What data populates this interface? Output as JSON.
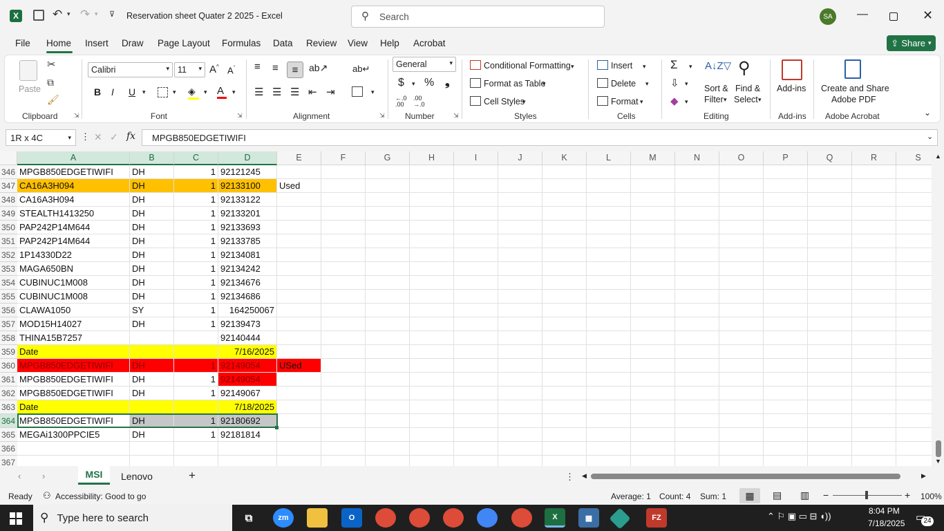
{
  "window": {
    "title": "Reservation sheet Quater 2 2025  -  Excel",
    "search_placeholder": "Search",
    "avatar": "SA"
  },
  "menu": [
    "File",
    "Home",
    "Insert",
    "Draw",
    "Page Layout",
    "Formulas",
    "Data",
    "Review",
    "View",
    "Help",
    "Acrobat"
  ],
  "share_label": "Share",
  "ribbon": {
    "clipboard": {
      "paste": "Paste",
      "label": "Clipboard"
    },
    "font": {
      "name": "Calibri",
      "size": "11",
      "label": "Font"
    },
    "alignment": {
      "label": "Alignment"
    },
    "number": {
      "format": "General",
      "label": "Number"
    },
    "styles": {
      "conditional": "Conditional Formatting",
      "table": "Format as Table",
      "cell_styles": "Cell Styles",
      "label": "Styles"
    },
    "cells": {
      "insert": "Insert",
      "delete": "Delete",
      "format": "Format",
      "label": "Cells"
    },
    "editing": {
      "sort1": "Sort &",
      "sort2": "Filter",
      "find1": "Find &",
      "find2": "Select",
      "label": "Editing"
    },
    "addins": {
      "btn": "Add-ins",
      "label": "Add-ins"
    },
    "acrobat": {
      "btn1": "Create and Share",
      "btn2": "Adobe PDF",
      "label": "Adobe Acrobat"
    }
  },
  "namebox": "1R x 4C",
  "formula": "MPGB850EDGETIWIFI",
  "columns": [
    "A",
    "B",
    "C",
    "D",
    "E",
    "F",
    "G",
    "H",
    "I",
    "J",
    "K",
    "L",
    "M",
    "N",
    "O",
    "P",
    "Q",
    "R",
    "S"
  ],
  "rows": [
    {
      "n": "346",
      "a": "MPGB850EDGETIWIFI",
      "b": "DH",
      "c": "1",
      "d": "92121245",
      "e": "",
      "style": ""
    },
    {
      "n": "347",
      "a": "CA16A3H094",
      "b": "DH",
      "c": "1",
      "d": "92133100",
      "e": "Used",
      "style": "orange"
    },
    {
      "n": "348",
      "a": "CA16A3H094",
      "b": "DH",
      "c": "1",
      "d": "92133122",
      "e": "",
      "style": ""
    },
    {
      "n": "349",
      "a": "STEALTH1413250",
      "b": "DH",
      "c": "1",
      "d": "92133201",
      "e": "",
      "style": ""
    },
    {
      "n": "350",
      "a": "PAP242P14M644",
      "b": "DH",
      "c": "1",
      "d": "92133693",
      "e": "",
      "style": ""
    },
    {
      "n": "351",
      "a": "PAP242P14M644",
      "b": "DH",
      "c": "1",
      "d": "92133785",
      "e": "",
      "style": ""
    },
    {
      "n": "352",
      "a": "1P14330D22",
      "b": "DH",
      "c": "1",
      "d": "92134081",
      "e": "",
      "style": ""
    },
    {
      "n": "353",
      "a": "MAGA650BN",
      "b": "DH",
      "c": "1",
      "d": "92134242",
      "e": "",
      "style": ""
    },
    {
      "n": "354",
      "a": "CUBINUC1M008",
      "b": "DH",
      "c": "1",
      "d": "92134676",
      "e": "",
      "style": ""
    },
    {
      "n": "355",
      "a": "CUBINUC1M008",
      "b": "DH",
      "c": "1",
      "d": "92134686",
      "e": "",
      "style": ""
    },
    {
      "n": "356",
      "a": "CLAWA1050",
      "b": "SY",
      "c": "1",
      "d": "164250067",
      "e": "",
      "style": "sy"
    },
    {
      "n": "357",
      "a": "MOD15H14027",
      "b": "DH",
      "c": "1",
      "d": "92139473",
      "e": "",
      "style": ""
    },
    {
      "n": "358",
      "a": "THINA15B7257",
      "b": "",
      "c": "",
      "d": "92140444",
      "e": "",
      "style": ""
    },
    {
      "n": "359",
      "a": "Date",
      "b": "",
      "c": "",
      "d": "7/16/2025",
      "e": "",
      "style": "date"
    },
    {
      "n": "360",
      "a": "MPGB850EDGETIWIFI",
      "b": "DH",
      "c": "1",
      "d": "92149054",
      "e": "USed",
      "style": "red"
    },
    {
      "n": "361",
      "a": "MPGB850EDGETIWIFI",
      "b": "DH",
      "c": "1",
      "d": "92149054",
      "e": "",
      "style": "redd"
    },
    {
      "n": "362",
      "a": "MPGB850EDGETIWIFI",
      "b": "DH",
      "c": "1",
      "d": "92149067",
      "e": "",
      "style": ""
    },
    {
      "n": "363",
      "a": "Date",
      "b": "",
      "c": "",
      "d": "7/18/2025",
      "e": "",
      "style": "date"
    },
    {
      "n": "364",
      "a": "MPGB850EDGETIWIFI",
      "b": "DH",
      "c": "1",
      "d": "92180692",
      "e": "",
      "style": "sel"
    },
    {
      "n": "365",
      "a": "MEGAi1300PPCIE5",
      "b": "DH",
      "c": "1",
      "d": "92181814",
      "e": "",
      "style": ""
    },
    {
      "n": "366",
      "a": "",
      "b": "",
      "c": "",
      "d": "",
      "e": "",
      "style": ""
    },
    {
      "n": "367",
      "a": "",
      "b": "",
      "c": "",
      "d": "",
      "e": "",
      "style": ""
    }
  ],
  "sheets": [
    "MSI",
    "Lenovo"
  ],
  "status": {
    "ready": "Ready",
    "accessibility": "Accessibility: Good to go",
    "average": "Average: 1",
    "count": "Count: 4",
    "sum": "Sum: 1",
    "zoom": "100%"
  },
  "taskbar": {
    "search": "Type here to search",
    "time": "8:04 PM",
    "date": "7/18/2025",
    "badge": "24"
  },
  "colors": {
    "excel_green": "#217346",
    "orange": "#ffc000",
    "yellow": "#ffff00",
    "red": "#ff0000",
    "selection": "#c6c6c6"
  }
}
